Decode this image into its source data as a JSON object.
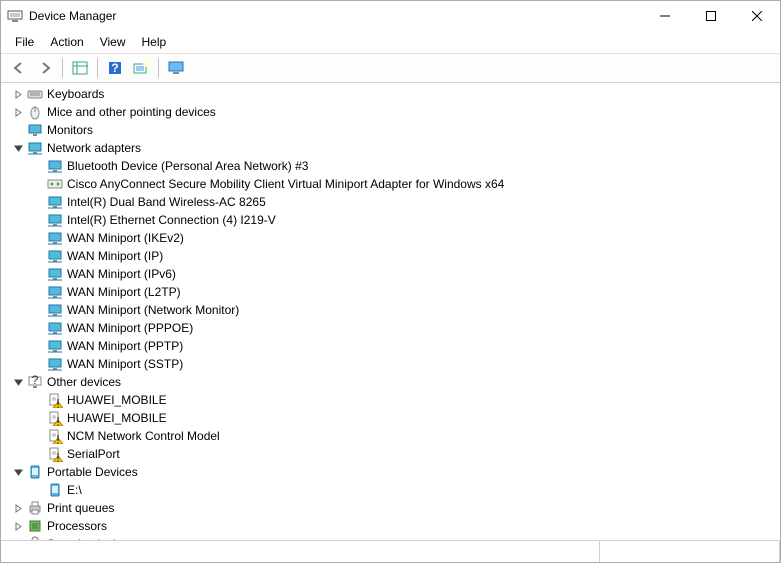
{
  "window": {
    "title": "Device Manager"
  },
  "menu": {
    "file": "File",
    "action": "Action",
    "view": "View",
    "help": "Help"
  },
  "tree": [
    {
      "level": 1,
      "expander": "right",
      "icon": "keyboard",
      "label": "Keyboards"
    },
    {
      "level": 1,
      "expander": "right",
      "icon": "mouse",
      "label": "Mice and other pointing devices"
    },
    {
      "level": 1,
      "expander": "none",
      "icon": "monitor",
      "label": "Monitors"
    },
    {
      "level": 1,
      "expander": "down",
      "icon": "network",
      "label": "Network adapters"
    },
    {
      "level": 2,
      "expander": "none",
      "icon": "net-adapter",
      "label": "Bluetooth Device (Personal Area Network) #3"
    },
    {
      "level": 2,
      "expander": "none",
      "icon": "net-virtual",
      "label": "Cisco AnyConnect Secure Mobility Client Virtual Miniport Adapter for Windows x64"
    },
    {
      "level": 2,
      "expander": "none",
      "icon": "net-adapter",
      "label": "Intel(R) Dual Band Wireless-AC 8265"
    },
    {
      "level": 2,
      "expander": "none",
      "icon": "net-adapter",
      "label": "Intel(R) Ethernet Connection (4) I219-V"
    },
    {
      "level": 2,
      "expander": "none",
      "icon": "net-adapter",
      "label": "WAN Miniport (IKEv2)"
    },
    {
      "level": 2,
      "expander": "none",
      "icon": "net-adapter",
      "label": "WAN Miniport (IP)"
    },
    {
      "level": 2,
      "expander": "none",
      "icon": "net-adapter",
      "label": "WAN Miniport (IPv6)"
    },
    {
      "level": 2,
      "expander": "none",
      "icon": "net-adapter",
      "label": "WAN Miniport (L2TP)"
    },
    {
      "level": 2,
      "expander": "none",
      "icon": "net-adapter",
      "label": "WAN Miniport (Network Monitor)"
    },
    {
      "level": 2,
      "expander": "none",
      "icon": "net-adapter",
      "label": "WAN Miniport (PPPOE)"
    },
    {
      "level": 2,
      "expander": "none",
      "icon": "net-adapter",
      "label": "WAN Miniport (PPTP)"
    },
    {
      "level": 2,
      "expander": "none",
      "icon": "net-adapter",
      "label": "WAN Miniport (SSTP)"
    },
    {
      "level": 1,
      "expander": "down",
      "icon": "other",
      "label": "Other devices"
    },
    {
      "level": 2,
      "expander": "none",
      "icon": "unknown-warn",
      "label": "HUAWEI_MOBILE"
    },
    {
      "level": 2,
      "expander": "none",
      "icon": "unknown-warn",
      "label": "HUAWEI_MOBILE"
    },
    {
      "level": 2,
      "expander": "none",
      "icon": "unknown-warn",
      "label": "NCM Network Control Model"
    },
    {
      "level": 2,
      "expander": "none",
      "icon": "unknown-warn",
      "label": "SerialPort"
    },
    {
      "level": 1,
      "expander": "down",
      "icon": "portable",
      "label": "Portable Devices"
    },
    {
      "level": 2,
      "expander": "none",
      "icon": "drive",
      "label": "E:\\"
    },
    {
      "level": 1,
      "expander": "right",
      "icon": "printer",
      "label": "Print queues"
    },
    {
      "level": 1,
      "expander": "right",
      "icon": "processor",
      "label": "Processors"
    },
    {
      "level": 1,
      "expander": "right",
      "icon": "security",
      "label": "Security devices"
    }
  ]
}
